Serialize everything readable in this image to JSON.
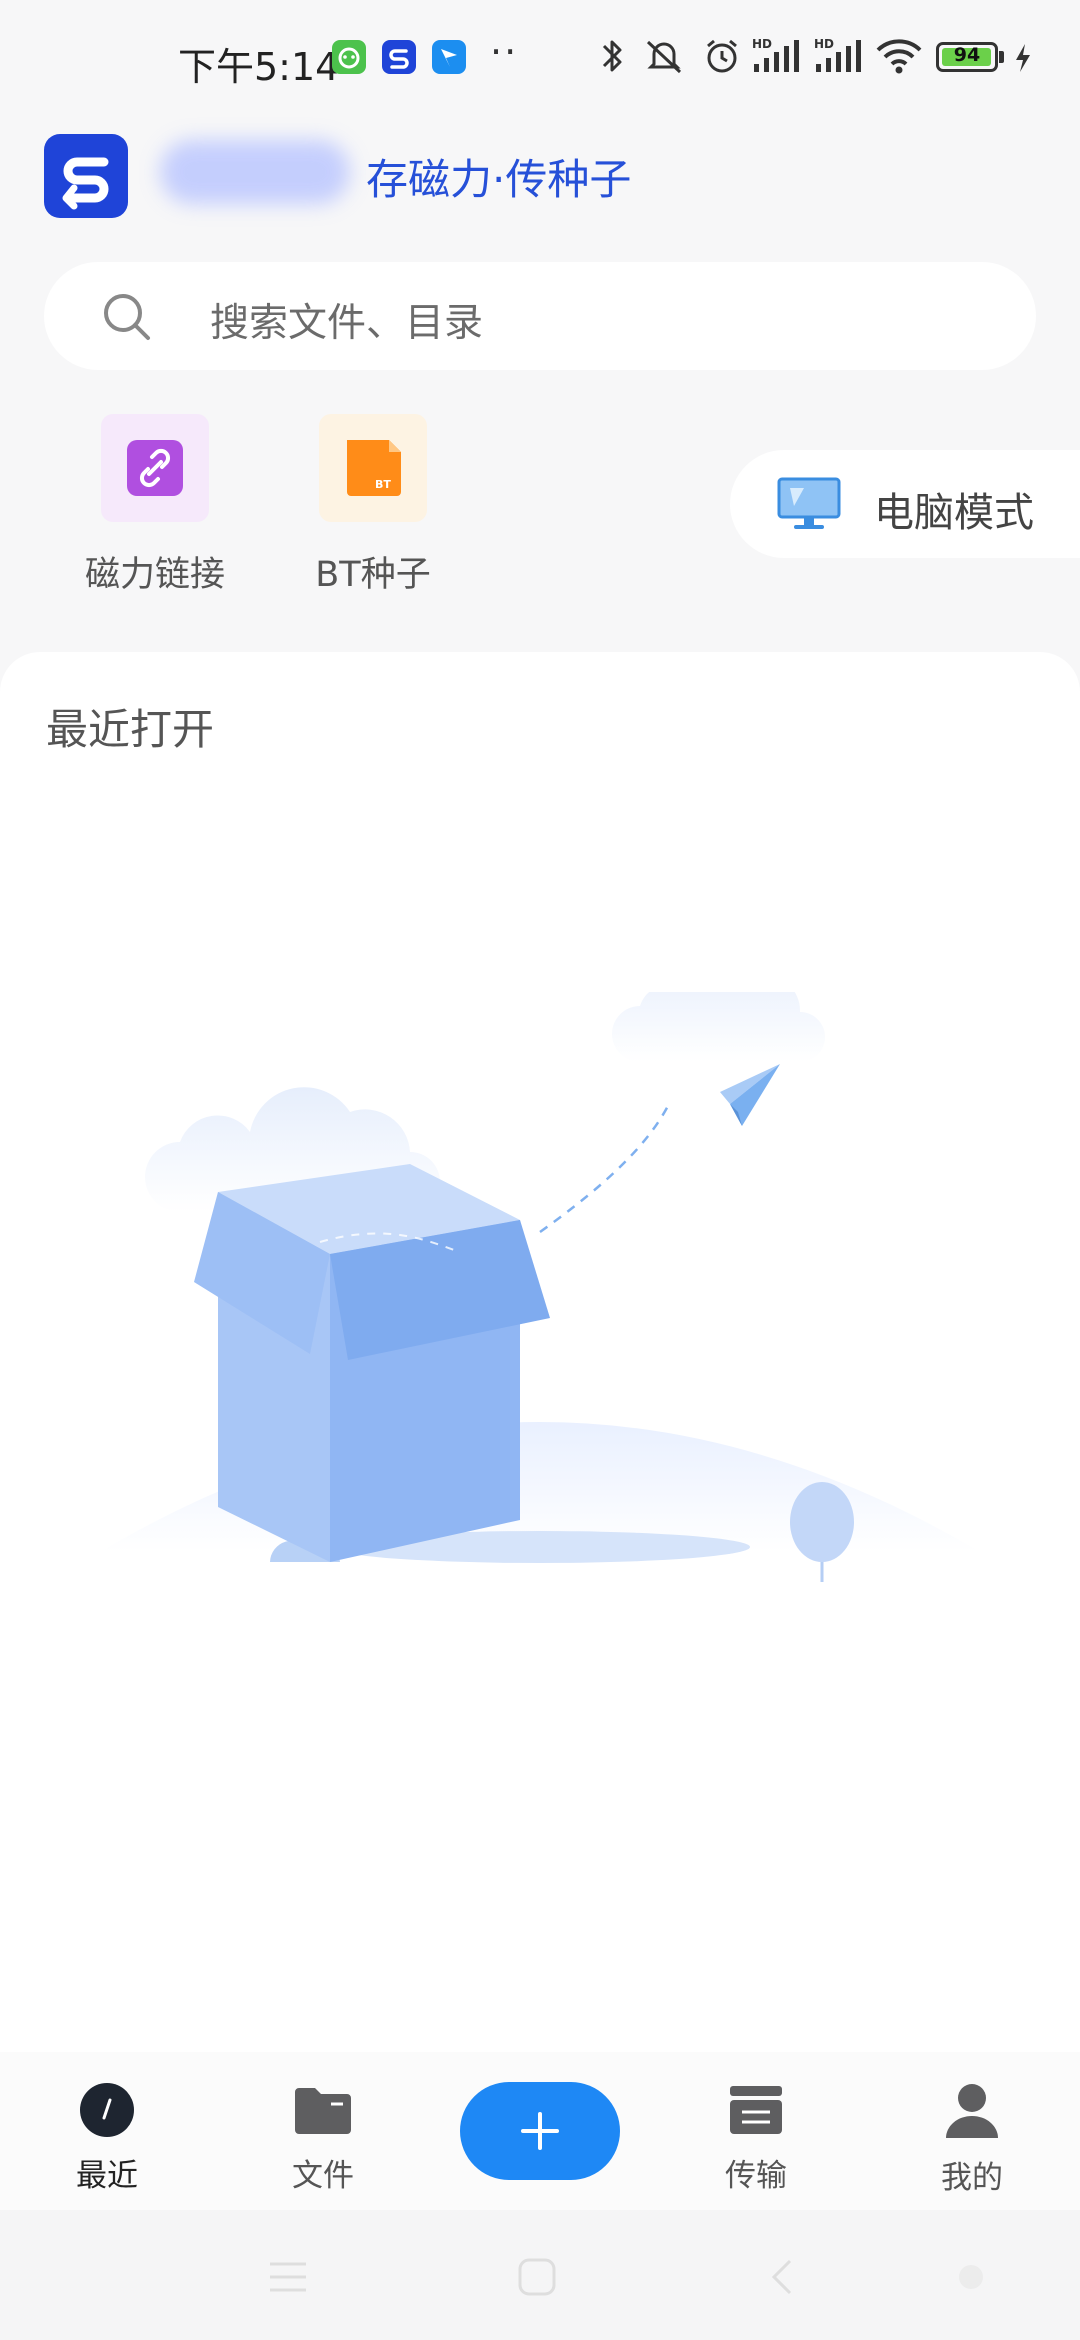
{
  "status_bar": {
    "time": "下午5:14",
    "battery": "94",
    "icons": [
      "wechat-app-icon",
      "netdisk-app-icon",
      "bird-app-icon",
      "more-dots-icon",
      "bluetooth-icon",
      "mute-icon",
      "alarm-icon",
      "signal-hd-1-icon",
      "signal-hd-2-icon",
      "wifi-icon",
      "battery-icon",
      "charging-icon"
    ],
    "dots": "··"
  },
  "header": {
    "slogan": "存磁力·传种子"
  },
  "search": {
    "placeholder": "搜索文件、目录"
  },
  "quick_actions": [
    {
      "label": "磁力链接",
      "icon": "link-icon",
      "color": "#b04fe0"
    },
    {
      "label": "BT种子",
      "icon": "bt-file-icon",
      "color": "#ff8c18",
      "badge": "BT"
    }
  ],
  "pc_mode": {
    "label": "电脑模式",
    "icon": "monitor-icon"
  },
  "recent": {
    "title": "最近打开",
    "empty_illustration": "empty-box-illustration"
  },
  "nav": {
    "items": [
      {
        "label": "最近",
        "icon": "recent-icon",
        "active": true
      },
      {
        "label": "文件",
        "icon": "folder-icon"
      },
      {
        "label": "传输",
        "icon": "transfer-icon"
      },
      {
        "label": "我的",
        "icon": "user-icon"
      }
    ],
    "fab_icon": "plus-icon"
  },
  "colors": {
    "accent": "#1e88f5",
    "brand": "#1f44d8",
    "slogan": "#2650d8"
  }
}
